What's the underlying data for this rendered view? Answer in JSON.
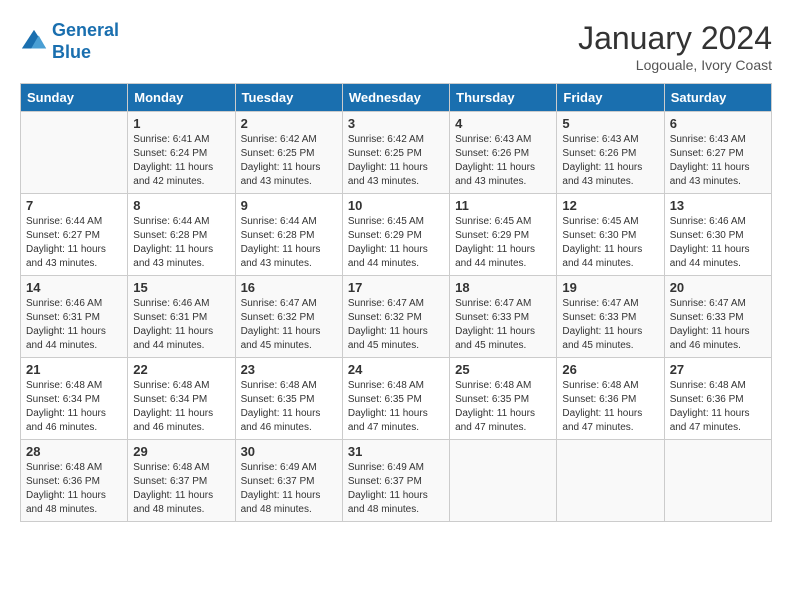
{
  "header": {
    "logo_line1": "General",
    "logo_line2": "Blue",
    "month": "January 2024",
    "location": "Logouale, Ivory Coast"
  },
  "weekdays": [
    "Sunday",
    "Monday",
    "Tuesday",
    "Wednesday",
    "Thursday",
    "Friday",
    "Saturday"
  ],
  "weeks": [
    [
      {
        "day": "",
        "sunrise": "",
        "sunset": "",
        "daylight": ""
      },
      {
        "day": "1",
        "sunrise": "Sunrise: 6:41 AM",
        "sunset": "Sunset: 6:24 PM",
        "daylight": "Daylight: 11 hours and 42 minutes."
      },
      {
        "day": "2",
        "sunrise": "Sunrise: 6:42 AM",
        "sunset": "Sunset: 6:25 PM",
        "daylight": "Daylight: 11 hours and 43 minutes."
      },
      {
        "day": "3",
        "sunrise": "Sunrise: 6:42 AM",
        "sunset": "Sunset: 6:25 PM",
        "daylight": "Daylight: 11 hours and 43 minutes."
      },
      {
        "day": "4",
        "sunrise": "Sunrise: 6:43 AM",
        "sunset": "Sunset: 6:26 PM",
        "daylight": "Daylight: 11 hours and 43 minutes."
      },
      {
        "day": "5",
        "sunrise": "Sunrise: 6:43 AM",
        "sunset": "Sunset: 6:26 PM",
        "daylight": "Daylight: 11 hours and 43 minutes."
      },
      {
        "day": "6",
        "sunrise": "Sunrise: 6:43 AM",
        "sunset": "Sunset: 6:27 PM",
        "daylight": "Daylight: 11 hours and 43 minutes."
      }
    ],
    [
      {
        "day": "7",
        "sunrise": "Sunrise: 6:44 AM",
        "sunset": "Sunset: 6:27 PM",
        "daylight": "Daylight: 11 hours and 43 minutes."
      },
      {
        "day": "8",
        "sunrise": "Sunrise: 6:44 AM",
        "sunset": "Sunset: 6:28 PM",
        "daylight": "Daylight: 11 hours and 43 minutes."
      },
      {
        "day": "9",
        "sunrise": "Sunrise: 6:44 AM",
        "sunset": "Sunset: 6:28 PM",
        "daylight": "Daylight: 11 hours and 43 minutes."
      },
      {
        "day": "10",
        "sunrise": "Sunrise: 6:45 AM",
        "sunset": "Sunset: 6:29 PM",
        "daylight": "Daylight: 11 hours and 44 minutes."
      },
      {
        "day": "11",
        "sunrise": "Sunrise: 6:45 AM",
        "sunset": "Sunset: 6:29 PM",
        "daylight": "Daylight: 11 hours and 44 minutes."
      },
      {
        "day": "12",
        "sunrise": "Sunrise: 6:45 AM",
        "sunset": "Sunset: 6:30 PM",
        "daylight": "Daylight: 11 hours and 44 minutes."
      },
      {
        "day": "13",
        "sunrise": "Sunrise: 6:46 AM",
        "sunset": "Sunset: 6:30 PM",
        "daylight": "Daylight: 11 hours and 44 minutes."
      }
    ],
    [
      {
        "day": "14",
        "sunrise": "Sunrise: 6:46 AM",
        "sunset": "Sunset: 6:31 PM",
        "daylight": "Daylight: 11 hours and 44 minutes."
      },
      {
        "day": "15",
        "sunrise": "Sunrise: 6:46 AM",
        "sunset": "Sunset: 6:31 PM",
        "daylight": "Daylight: 11 hours and 44 minutes."
      },
      {
        "day": "16",
        "sunrise": "Sunrise: 6:47 AM",
        "sunset": "Sunset: 6:32 PM",
        "daylight": "Daylight: 11 hours and 45 minutes."
      },
      {
        "day": "17",
        "sunrise": "Sunrise: 6:47 AM",
        "sunset": "Sunset: 6:32 PM",
        "daylight": "Daylight: 11 hours and 45 minutes."
      },
      {
        "day": "18",
        "sunrise": "Sunrise: 6:47 AM",
        "sunset": "Sunset: 6:33 PM",
        "daylight": "Daylight: 11 hours and 45 minutes."
      },
      {
        "day": "19",
        "sunrise": "Sunrise: 6:47 AM",
        "sunset": "Sunset: 6:33 PM",
        "daylight": "Daylight: 11 hours and 45 minutes."
      },
      {
        "day": "20",
        "sunrise": "Sunrise: 6:47 AM",
        "sunset": "Sunset: 6:33 PM",
        "daylight": "Daylight: 11 hours and 46 minutes."
      }
    ],
    [
      {
        "day": "21",
        "sunrise": "Sunrise: 6:48 AM",
        "sunset": "Sunset: 6:34 PM",
        "daylight": "Daylight: 11 hours and 46 minutes."
      },
      {
        "day": "22",
        "sunrise": "Sunrise: 6:48 AM",
        "sunset": "Sunset: 6:34 PM",
        "daylight": "Daylight: 11 hours and 46 minutes."
      },
      {
        "day": "23",
        "sunrise": "Sunrise: 6:48 AM",
        "sunset": "Sunset: 6:35 PM",
        "daylight": "Daylight: 11 hours and 46 minutes."
      },
      {
        "day": "24",
        "sunrise": "Sunrise: 6:48 AM",
        "sunset": "Sunset: 6:35 PM",
        "daylight": "Daylight: 11 hours and 47 minutes."
      },
      {
        "day": "25",
        "sunrise": "Sunrise: 6:48 AM",
        "sunset": "Sunset: 6:35 PM",
        "daylight": "Daylight: 11 hours and 47 minutes."
      },
      {
        "day": "26",
        "sunrise": "Sunrise: 6:48 AM",
        "sunset": "Sunset: 6:36 PM",
        "daylight": "Daylight: 11 hours and 47 minutes."
      },
      {
        "day": "27",
        "sunrise": "Sunrise: 6:48 AM",
        "sunset": "Sunset: 6:36 PM",
        "daylight": "Daylight: 11 hours and 47 minutes."
      }
    ],
    [
      {
        "day": "28",
        "sunrise": "Sunrise: 6:48 AM",
        "sunset": "Sunset: 6:36 PM",
        "daylight": "Daylight: 11 hours and 48 minutes."
      },
      {
        "day": "29",
        "sunrise": "Sunrise: 6:48 AM",
        "sunset": "Sunset: 6:37 PM",
        "daylight": "Daylight: 11 hours and 48 minutes."
      },
      {
        "day": "30",
        "sunrise": "Sunrise: 6:49 AM",
        "sunset": "Sunset: 6:37 PM",
        "daylight": "Daylight: 11 hours and 48 minutes."
      },
      {
        "day": "31",
        "sunrise": "Sunrise: 6:49 AM",
        "sunset": "Sunset: 6:37 PM",
        "daylight": "Daylight: 11 hours and 48 minutes."
      },
      {
        "day": "",
        "sunrise": "",
        "sunset": "",
        "daylight": ""
      },
      {
        "day": "",
        "sunrise": "",
        "sunset": "",
        "daylight": ""
      },
      {
        "day": "",
        "sunrise": "",
        "sunset": "",
        "daylight": ""
      }
    ]
  ]
}
